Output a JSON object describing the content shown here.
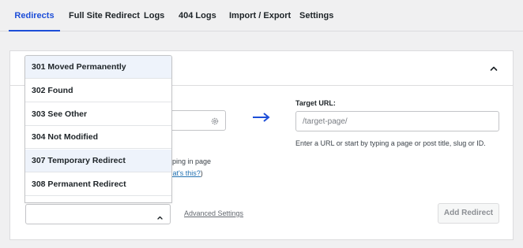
{
  "tabs": [
    {
      "label": "Redirects",
      "active": true
    },
    {
      "label": "Full Site Redirect",
      "active": false
    },
    {
      "label": "Logs",
      "active": false
    },
    {
      "label": "404 Logs",
      "active": false
    },
    {
      "label": "Import / Export",
      "active": false
    },
    {
      "label": "Settings",
      "active": false
    }
  ],
  "colors": {
    "accent": "#1d4ed8",
    "link": "#2271b1",
    "highlight_row": "#eef3fb"
  },
  "redirect_types": [
    {
      "label": "301 Moved Permanently",
      "highlighted": true
    },
    {
      "label": "302 Found",
      "highlighted": false
    },
    {
      "label": "303 See Other",
      "highlighted": false
    },
    {
      "label": "304 Not Modified",
      "highlighted": false
    },
    {
      "label": "307 Temporary Redirect",
      "highlighted": true
    },
    {
      "label": "308 Permanent Redirect",
      "highlighted": false
    }
  ],
  "source": {
    "help_line1": "y typing in page",
    "help_prefix": "(",
    "whats_this": "what's this?",
    "help_suffix": ")",
    "settings_icon": "gear-icon"
  },
  "target": {
    "label": "Target URL:",
    "placeholder": "/target-page/",
    "help": "Enter a URL or start by typing a page or post title, slug or ID."
  },
  "bottom": {
    "advanced_settings": "Advanced Settings",
    "add_redirect": "Add Redirect"
  },
  "icons": {
    "collapse": "chevron-up-icon",
    "arrow": "arrow-right-icon",
    "select_chevron": "chevron-up-icon"
  }
}
